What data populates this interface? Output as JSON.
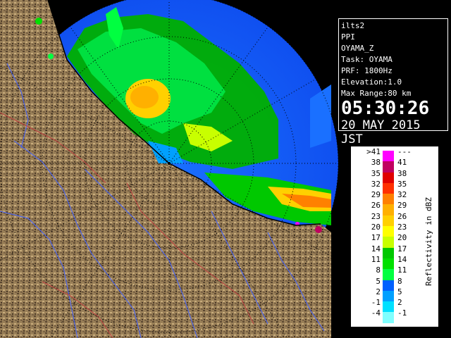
{
  "info": {
    "site_id": "ilts2",
    "product": "PPI",
    "radar_name": "OYAMA_Z",
    "task": "Task: OYAMA",
    "prf": "PRF: 1800Hz",
    "elevation": "Elevation:1.0",
    "max_range": "Max Range:80 km",
    "time": "05:30:26",
    "date": "20 MAY 2015 JST"
  },
  "legend": {
    "axis_label": "Reflectivity in dBZ",
    "left_labels": [
      ">41",
      "38",
      "35",
      "32",
      "29",
      "26",
      "23",
      "20",
      "17",
      "14",
      "11",
      "8",
      "5",
      "2",
      "-1",
      "-4"
    ],
    "right_labels": [
      "---",
      "41",
      "38",
      "35",
      "32",
      "29",
      "26",
      "23",
      "20",
      "17",
      "14",
      "11",
      "8",
      "5",
      "2",
      "-1"
    ],
    "colors": [
      "#ff00ff",
      "#c00060",
      "#e00000",
      "#ff3000",
      "#ff8000",
      "#ffb000",
      "#ffd000",
      "#ffff00",
      "#c8ff00",
      "#00c800",
      "#00e000",
      "#00ff40",
      "#0060ff",
      "#00a0ff",
      "#00e0ff",
      "#80ffff"
    ]
  },
  "colors": {
    "terrain_light": "#b89a6a",
    "terrain_dark": "#5a4630",
    "sea_echo": "#1060ff",
    "range_ring": "#000000",
    "river": "#4060ff",
    "boundary": "#c04040"
  }
}
